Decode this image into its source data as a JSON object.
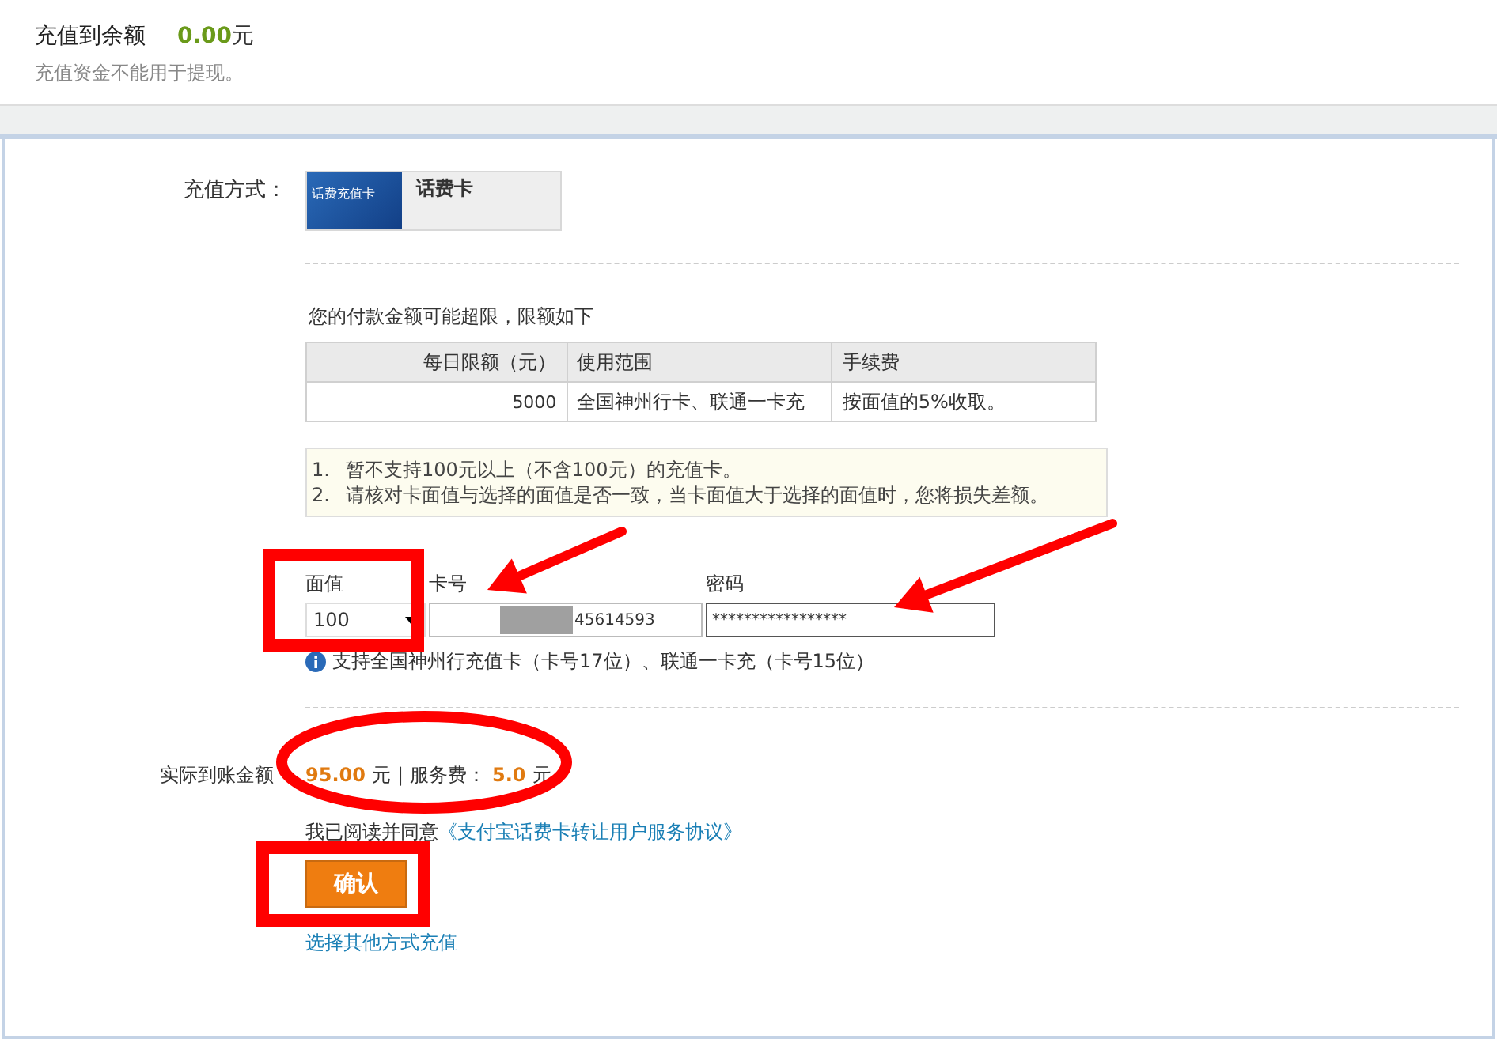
{
  "balance": {
    "title": "充值到余额",
    "amount": "0.00",
    "unit": "元",
    "note": "充值资金不能用于提现。"
  },
  "method": {
    "label": "充值方式：",
    "card_image_text": "话费充值卡",
    "card_name": "话费卡",
    "selected": true
  },
  "limits": {
    "title": "您的付款金额可能超限，限额如下",
    "columns": [
      "每日限额（元）",
      "使用范围",
      "手续费"
    ],
    "rows": [
      [
        "5000",
        "全国神州行卡、联通一卡充",
        "按面值的5%收取。"
      ]
    ]
  },
  "notices": [
    {
      "number": "1.",
      "text": "暂不支持100元以上（不含100元）的充值卡。"
    },
    {
      "number": "2.",
      "text": "请核对卡面值与选择的面值是否一致，当卡面值大于选择的面值时，您将损失差额。"
    }
  ],
  "fields": [
    {
      "kind": "select",
      "label": "面值",
      "value": "100"
    },
    {
      "kind": "masked",
      "label": "卡号",
      "value": "45614593"
    },
    {
      "kind": "password",
      "label": "密码",
      "value": "*****************"
    }
  ],
  "hint": "支持全国神州行充值卡（卡号17位）、联通一卡充（卡号15位）",
  "result": {
    "label": "实际到账金额",
    "amount": "95.00",
    "unit": "元",
    "separator": "|",
    "fee_label": "服务费：",
    "fee": "5.0",
    "fee_unit": "元"
  },
  "agreement": {
    "text": "我已阅读并同意",
    "link": "《支付宝话费卡转让用户服务协议》"
  },
  "confirm_button": "确认",
  "other_link": "选择其他方式充值",
  "annotations": [
    {
      "kind": "rectangle"
    },
    {
      "kind": "arrow"
    },
    {
      "kind": "arrow"
    },
    {
      "kind": "ellipse"
    },
    {
      "kind": "rectangle"
    }
  ]
}
